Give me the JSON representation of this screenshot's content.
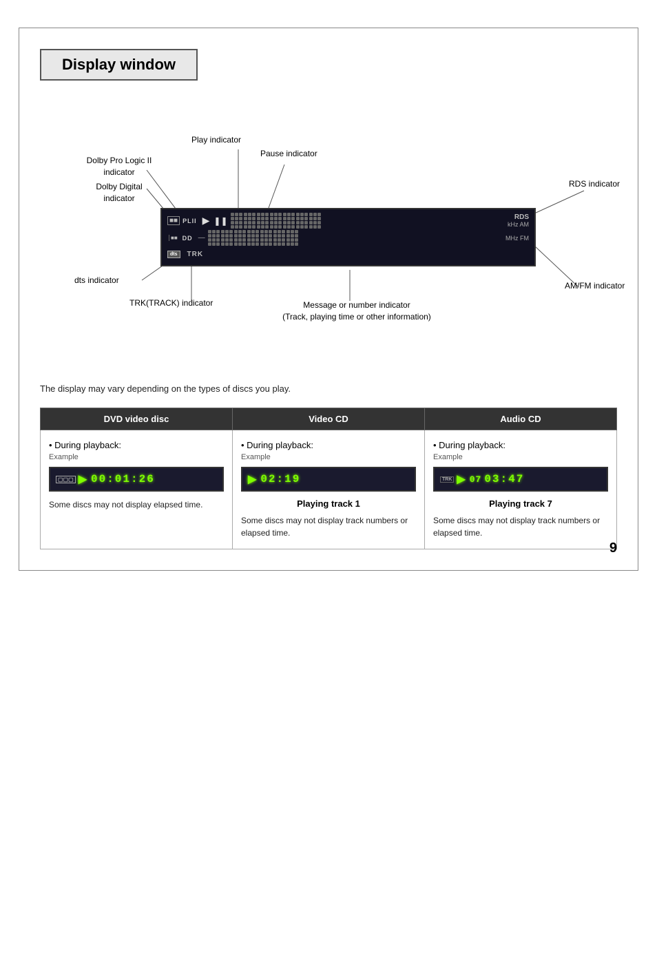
{
  "page": {
    "number": "9",
    "title": "Display window"
  },
  "diagram": {
    "title": "Display window",
    "annotations": [
      {
        "id": "play-indicator",
        "label": "Play indicator"
      },
      {
        "id": "pause-indicator",
        "label": "Pause indicator"
      },
      {
        "id": "dolby-prologic",
        "label": "Dolby Pro Logic II\nindicator"
      },
      {
        "id": "dolby-digital",
        "label": "Dolby Digital\nindicator"
      },
      {
        "id": "dts-indicator",
        "label": "dts indicator"
      },
      {
        "id": "trk-indicator",
        "label": "TRK(TRACK) indicator"
      },
      {
        "id": "message-indicator",
        "label": "Message or number indicator\n(Track, playing time or other information)"
      },
      {
        "id": "rds-indicator",
        "label": "RDS indicator"
      },
      {
        "id": "amfm-indicator",
        "label": "AM/FM indicator"
      }
    ],
    "lcd_labels": {
      "plii": "PLII",
      "dd": "DD",
      "dts": "dts",
      "trk": "TRK",
      "rds": "RDS",
      "khz": "kHz",
      "am": "AM",
      "mhz": "MHz",
      "fm": "FM"
    }
  },
  "note": "The display may vary depending on the types of discs you play.",
  "table": {
    "columns": [
      {
        "header": "DVD video disc",
        "bullet": "During playback:",
        "example_label": "Example",
        "display_text": "00:01:26",
        "display_prefix": "▶",
        "display_icon": "DVD",
        "track_label": "",
        "note": "Some discs may not display elapsed time."
      },
      {
        "header": "Video CD",
        "bullet": "During playback:",
        "example_label": "Example",
        "display_text": "02:19",
        "display_prefix": "▶",
        "display_icon": "",
        "track_label": "Playing track 1",
        "note": "Some discs may not display track numbers or elapsed time."
      },
      {
        "header": "Audio CD",
        "bullet": "During playback:",
        "example_label": "Example",
        "display_text": "03:47",
        "display_prefix": "▶",
        "display_icon": "TRK",
        "track_num": "07",
        "track_label": "Playing track 7",
        "note": "Some discs may not display track numbers or elapsed time."
      }
    ]
  }
}
